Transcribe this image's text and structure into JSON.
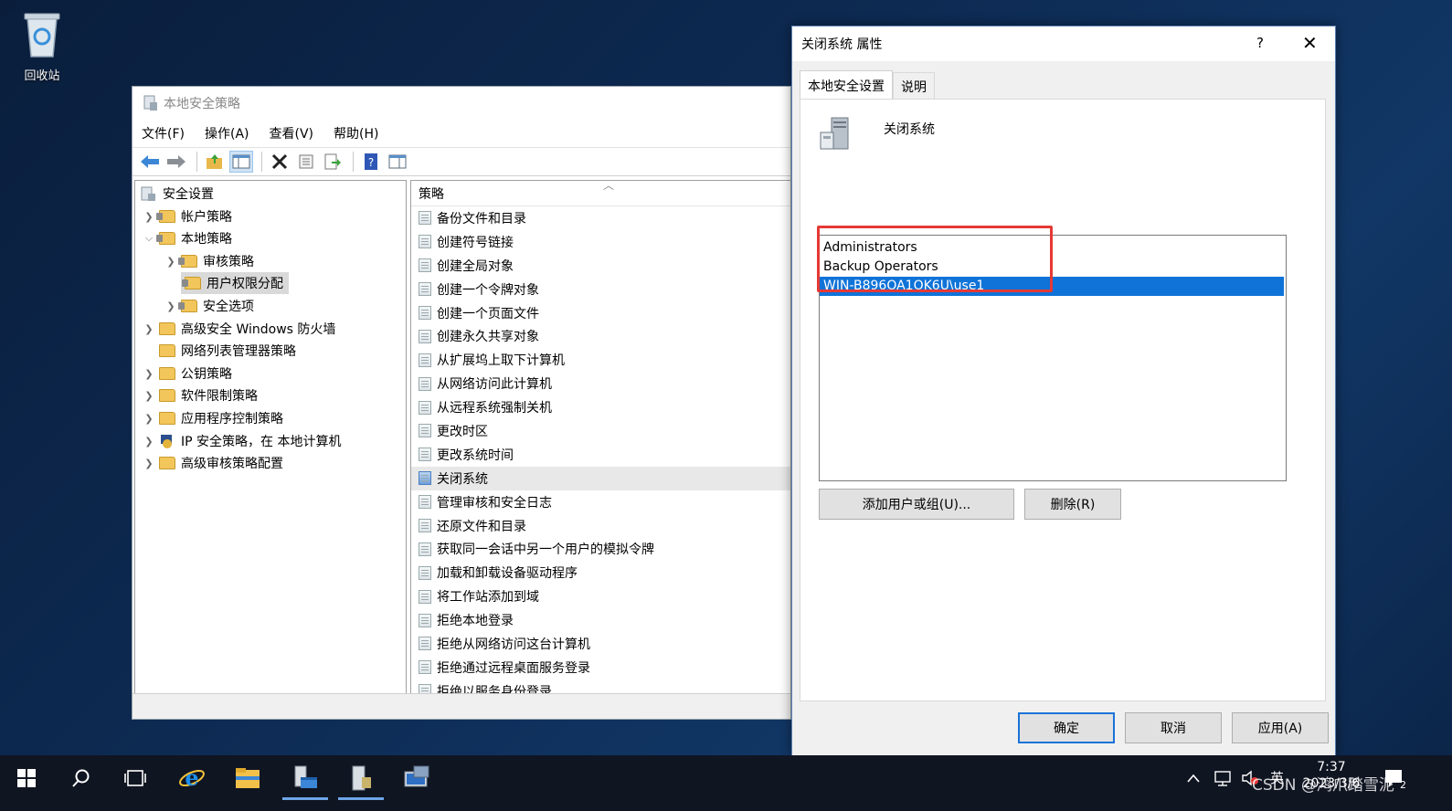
{
  "desktop": {
    "recycle_bin": "回收站"
  },
  "mmc": {
    "title": "本地安全策略",
    "menu": [
      "文件(F)",
      "操作(A)",
      "查看(V)",
      "帮助(H)"
    ],
    "tree": {
      "root": "安全设置",
      "items": [
        {
          "label": "帐户策略"
        },
        {
          "label": "本地策略"
        },
        {
          "label": "审核策略"
        },
        {
          "label": "用户权限分配"
        },
        {
          "label": "安全选项"
        },
        {
          "label": "高级安全 Windows 防火墙"
        },
        {
          "label": "网络列表管理器策略"
        },
        {
          "label": "公钥策略"
        },
        {
          "label": "软件限制策略"
        },
        {
          "label": "应用程序控制策略"
        },
        {
          "label": "IP 安全策略，在 本地计算机"
        },
        {
          "label": "高级审核策略配置"
        }
      ]
    },
    "list": {
      "header": "策略",
      "items": [
        "备份文件和目录",
        "创建符号链接",
        "创建全局对象",
        "创建一个令牌对象",
        "创建一个页面文件",
        "创建永久共享对象",
        "从扩展坞上取下计算机",
        "从网络访问此计算机",
        "从远程系统强制关机",
        "更改时区",
        "更改系统时间",
        "关闭系统",
        "管理审核和安全日志",
        "还原文件和目录",
        "获取同一会话中另一个用户的模拟令牌",
        "加载和卸载设备驱动程序",
        "将工作站添加到域",
        "拒绝本地登录",
        "拒绝从网络访问这台计算机",
        "拒绝通过远程桌面服务登录",
        "拒绝以服务身份登录"
      ],
      "selected": "关闭系统"
    }
  },
  "dialog": {
    "title": "关闭系统 属性",
    "help": "?",
    "close": "✕",
    "tabs": [
      "本地安全设置",
      "说明"
    ],
    "policy_name": "关闭系统",
    "users": [
      "Administrators",
      "Backup Operators",
      "WIN-B896OA1OK6U\\use1"
    ],
    "selected_user": "WIN-B896OA1OK6U\\use1",
    "add_button": "添加用户或组(U)...",
    "remove_button": "删除(R)",
    "ok_button": "确定",
    "cancel_button": "取消",
    "apply_button": "应用(A)",
    "highlight_color": "#e53935",
    "selection_color": "#0f73d8"
  },
  "taskbar": {
    "ime": "英",
    "time": "7:37",
    "date": "2023/3/6",
    "notification_count": "2",
    "watermark": "CSDN @鸿爪踏雪泥"
  }
}
